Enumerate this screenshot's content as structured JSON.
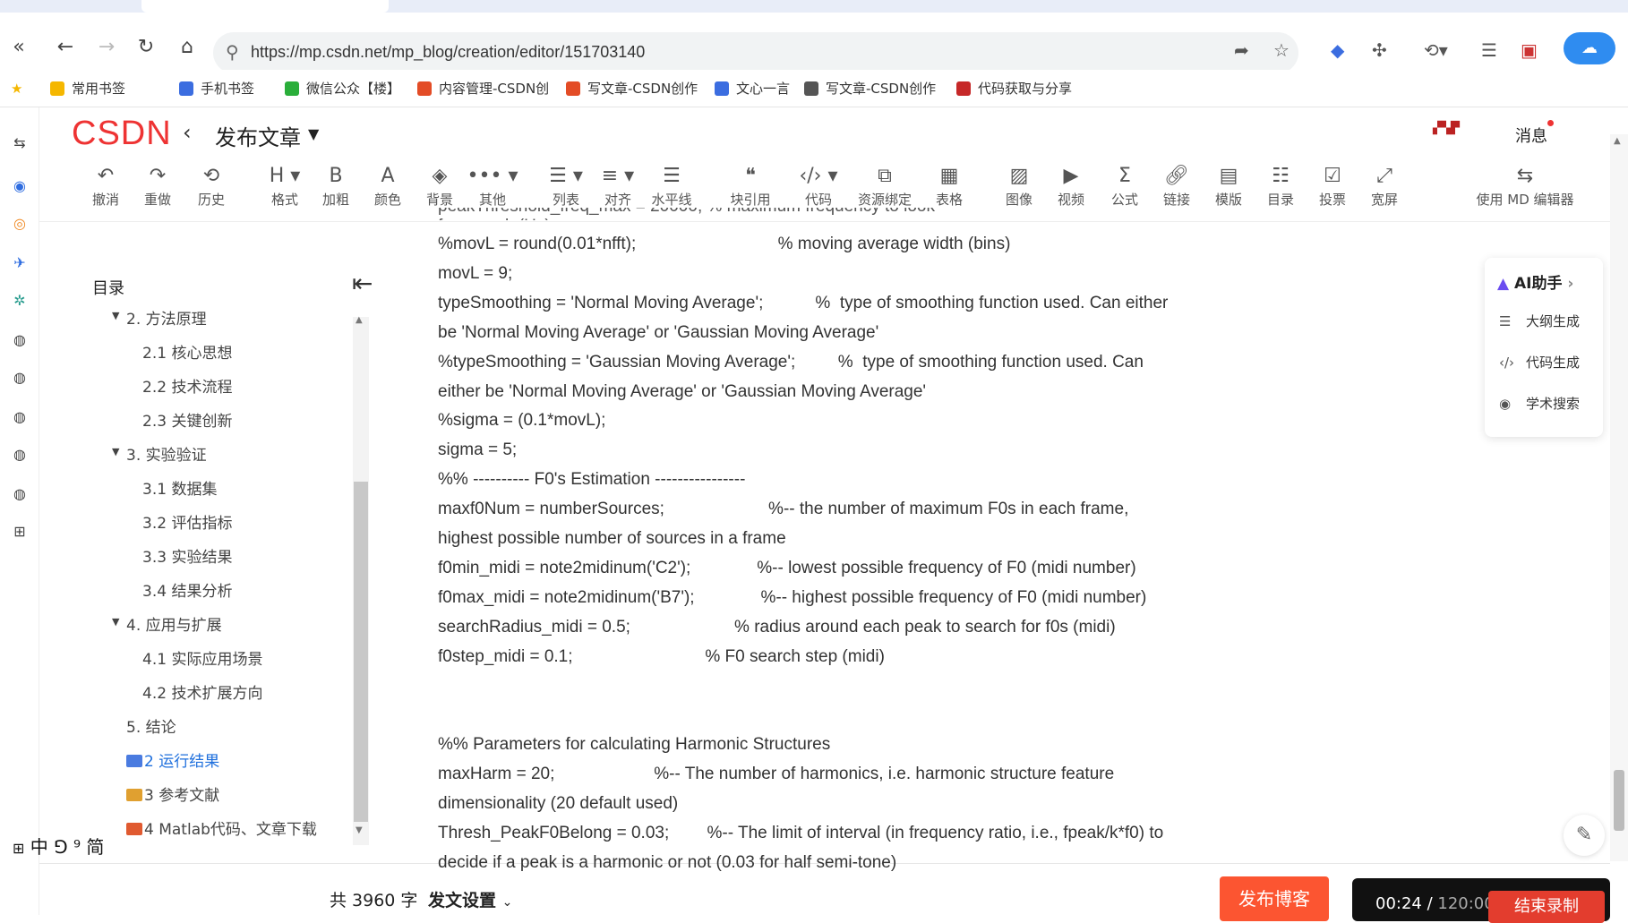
{
  "browser": {
    "url": "https://mp.csdn.net/mp_blog/creation/editor/151703140",
    "bookmarks": [
      {
        "label": "常用书签",
        "color": "#f5b700"
      },
      {
        "label": "手机书签",
        "color": "#3b6de0"
      },
      {
        "label": "微信公众【楼】",
        "color": "#2aae3a"
      },
      {
        "label": "内容管理-CSDN创",
        "color": "#e34c26"
      },
      {
        "label": "写文章-CSDN创作",
        "color": "#e34c26"
      },
      {
        "label": "文心一言",
        "color": "#3b6de0"
      },
      {
        "label": "写文章-CSDN创作",
        "color": "#555555"
      },
      {
        "label": "代码获取与分享",
        "color": "#c62828"
      }
    ]
  },
  "header": {
    "logo": "CSDN",
    "title": "发布文章",
    "messages": "消息"
  },
  "toolbar": [
    {
      "label": "撤消",
      "icon": "undo-icon",
      "glyph": "↶"
    },
    {
      "label": "重做",
      "icon": "redo-icon",
      "glyph": "↷"
    },
    {
      "label": "历史",
      "icon": "history-icon",
      "glyph": "⟲"
    },
    {
      "label": "格式",
      "icon": "heading-icon",
      "glyph": "H ▾"
    },
    {
      "label": "加粗",
      "icon": "bold-icon",
      "glyph": "B"
    },
    {
      "label": "颜色",
      "icon": "font-color-icon",
      "glyph": "A"
    },
    {
      "label": "背景",
      "icon": "paint-bucket-icon",
      "glyph": "◈"
    },
    {
      "label": "其他",
      "icon": "more-icon",
      "glyph": "••• ▾"
    },
    {
      "label": "列表",
      "icon": "list-icon",
      "glyph": "☰ ▾"
    },
    {
      "label": "对齐",
      "icon": "align-icon",
      "glyph": "≡ ▾"
    },
    {
      "label": "水平线",
      "icon": "horizontal-rule-icon",
      "glyph": "☰"
    },
    {
      "label": "块引用",
      "icon": "quote-icon",
      "glyph": "❝"
    },
    {
      "label": "代码",
      "icon": "code-icon",
      "glyph": "‹/› ▾"
    },
    {
      "label": "资源绑定",
      "icon": "resource-icon",
      "glyph": "⧉"
    },
    {
      "label": "表格",
      "icon": "table-icon",
      "glyph": "▦"
    },
    {
      "label": "图像",
      "icon": "image-icon",
      "glyph": "▨"
    },
    {
      "label": "视频",
      "icon": "video-icon",
      "glyph": "▶"
    },
    {
      "label": "公式",
      "icon": "formula-icon",
      "glyph": "Σ"
    },
    {
      "label": "链接",
      "icon": "link-icon",
      "glyph": "🔗︎"
    },
    {
      "label": "模版",
      "icon": "template-icon",
      "glyph": "▤"
    },
    {
      "label": "目录",
      "icon": "toc-icon",
      "glyph": "☷"
    },
    {
      "label": "投票",
      "icon": "vote-icon",
      "glyph": "☑"
    },
    {
      "label": "宽屏",
      "icon": "widescreen-icon",
      "glyph": "⤢"
    },
    {
      "label": "使用 MD 编辑器",
      "icon": "switch-editor-icon",
      "glyph": "⇆"
    }
  ],
  "toc": {
    "title": "目录",
    "items": [
      {
        "label": "2. 方法原理",
        "level": 1,
        "caret": true
      },
      {
        "label": "2.1 核心思想",
        "level": 2
      },
      {
        "label": "2.2 技术流程",
        "level": 2
      },
      {
        "label": "2.3 关键创新",
        "level": 2
      },
      {
        "label": "3. 实验验证",
        "level": 1,
        "caret": true
      },
      {
        "label": "3.1 数据集",
        "level": 2
      },
      {
        "label": "3.2 评估指标",
        "level": 2
      },
      {
        "label": "3.3 实验结果",
        "level": 2
      },
      {
        "label": "3.4 结果分析",
        "level": 2
      },
      {
        "label": "4. 应用与扩展",
        "level": 1,
        "caret": true
      },
      {
        "label": "4.1 实际应用场景",
        "level": 2
      },
      {
        "label": "4.2 技术扩展方向",
        "level": 2
      },
      {
        "label": "5. 结论",
        "level": 1
      },
      {
        "label": "2 运行结果",
        "level": 1,
        "active": true,
        "icon": "books-icon"
      },
      {
        "label": "3 参考文献",
        "level": 1,
        "icon": "party-icon"
      },
      {
        "label": "4 Matlab代码、文章下载",
        "level": 1,
        "icon": "rainbow-icon"
      }
    ]
  },
  "content": {
    "lines": [
      "%movL = round(0.01*nfft);                              % moving average width (bins)",
      "movL = 9;",
      "typeSmoothing = 'Normal Moving Average';           %  type of smoothing function used. Can either",
      "be 'Normal Moving Average' or 'Gaussian Moving Average'",
      "%typeSmoothing = 'Gaussian Moving Average';         %  type of smoothing function used. Can",
      "either be 'Normal Moving Average' or 'Gaussian Moving Average'",
      "%sigma = (0.1*movL);",
      "sigma = 5;",
      "%% ---------- F0's Estimation ----------------",
      "maxf0Num = numberSources;                      %-- the number of maximum F0s in each frame,",
      "highest possible number of sources in a frame",
      "f0min_midi = note2midinum('C2');              %-- lowest possible frequency of F0 (midi number)",
      "f0max_midi = note2midinum('B7');              %-- highest possible frequency of F0 (midi number)",
      "searchRadius_midi = 0.5;                      % radius around each peak to search for f0s (midi)",
      "f0step_midi = 0.1;                            % F0 search step (midi)",
      "",
      "",
      "%% Parameters for calculating Harmonic Structures",
      "maxHarm = 20;                     %-- The number of harmonics, i.e. harmonic structure feature",
      "dimensionality (20 default used)",
      "Thresh_PeakF0Belong = 0.03;        %-- The limit of interval (in frequency ratio, i.e., fpeak/k*f0) to",
      "decide if a peak is a harmonic or not (0.03 for half semi-tone)"
    ]
  },
  "ai": {
    "title": "AI助手",
    "items": [
      {
        "label": "大纲生成",
        "icon": "outline-icon",
        "glyph": "☰"
      },
      {
        "label": "代码生成",
        "icon": "code-gen-icon",
        "glyph": "‹/›"
      },
      {
        "label": "学术搜索",
        "icon": "academic-search-icon",
        "glyph": "◉"
      }
    ]
  },
  "ime": "中 ⅁ ⁹ 简",
  "footer": {
    "wordcount": "共 3960 字",
    "settings": "发文设置",
    "publish": "发布博客",
    "timer_elapsed": "00:24",
    "timer_total": "120:00",
    "stop_recording": "结束录制"
  },
  "colors": {
    "brand": "#fc5531",
    "link_blue": "#1e6fdd"
  }
}
